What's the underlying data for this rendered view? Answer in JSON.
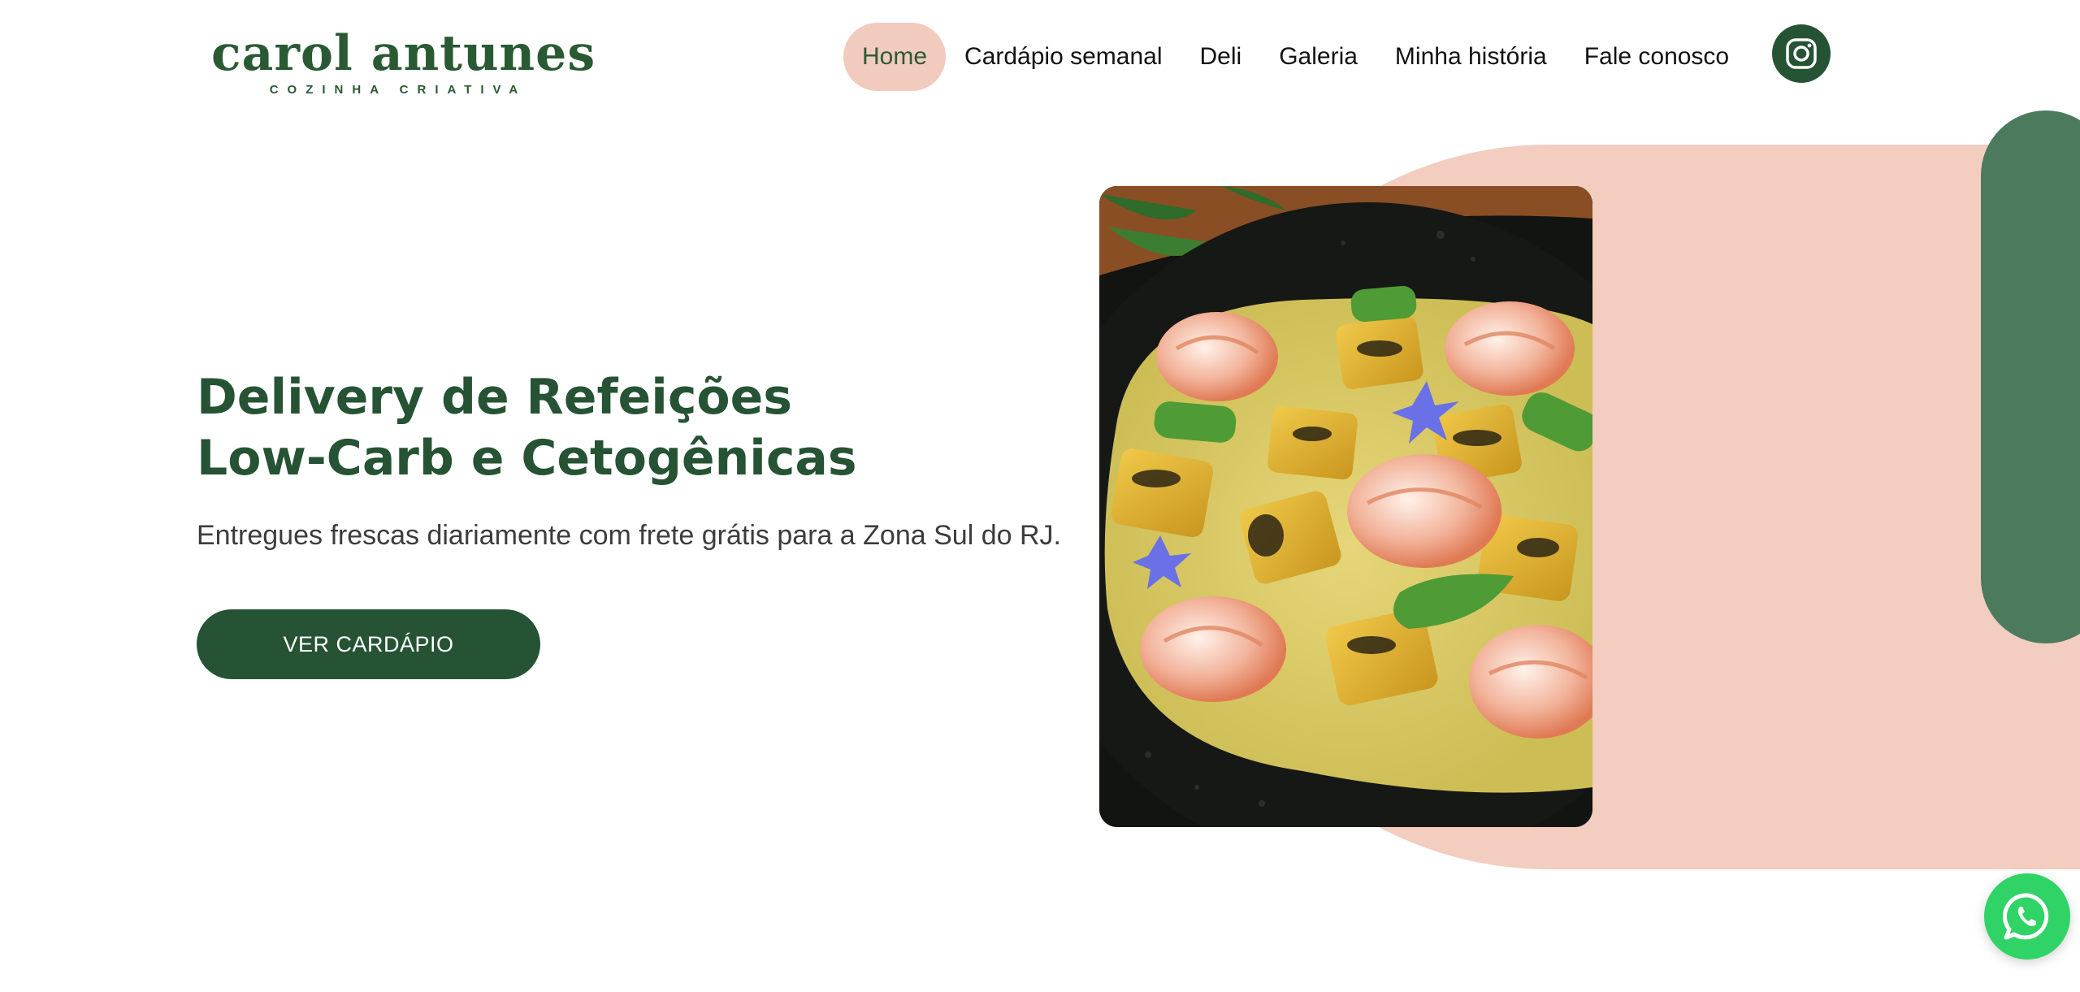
{
  "brand": {
    "name": "carol antunes",
    "tagline": "COZINHA CRIATIVA"
  },
  "nav": {
    "items": [
      {
        "label": "Home",
        "active": true
      },
      {
        "label": "Cardápio semanal",
        "active": false
      },
      {
        "label": "Deli",
        "active": false
      },
      {
        "label": "Galeria",
        "active": false
      },
      {
        "label": "Minha história",
        "active": false
      },
      {
        "label": "Fale conosco",
        "active": false
      }
    ]
  },
  "social": {
    "instagram_icon": "instagram-icon",
    "whatsapp_icon": "whatsapp-icon"
  },
  "hero": {
    "title_line1": "Delivery de Refeições",
    "title_line2": "Low-Carb e Cetogênicas",
    "subtitle": "Entregues frescas diariamente com frete grátis para a Zona Sul do RJ.",
    "cta_label": "VER CARDÁPIO",
    "image_alt": "Prato com camarões, abóbora grelhada e creme"
  },
  "colors": {
    "brand_green": "#255333",
    "accent_pink": "#f1cbbd",
    "pill_green": "#4b7a5c",
    "whatsapp_green": "#2fd366"
  }
}
